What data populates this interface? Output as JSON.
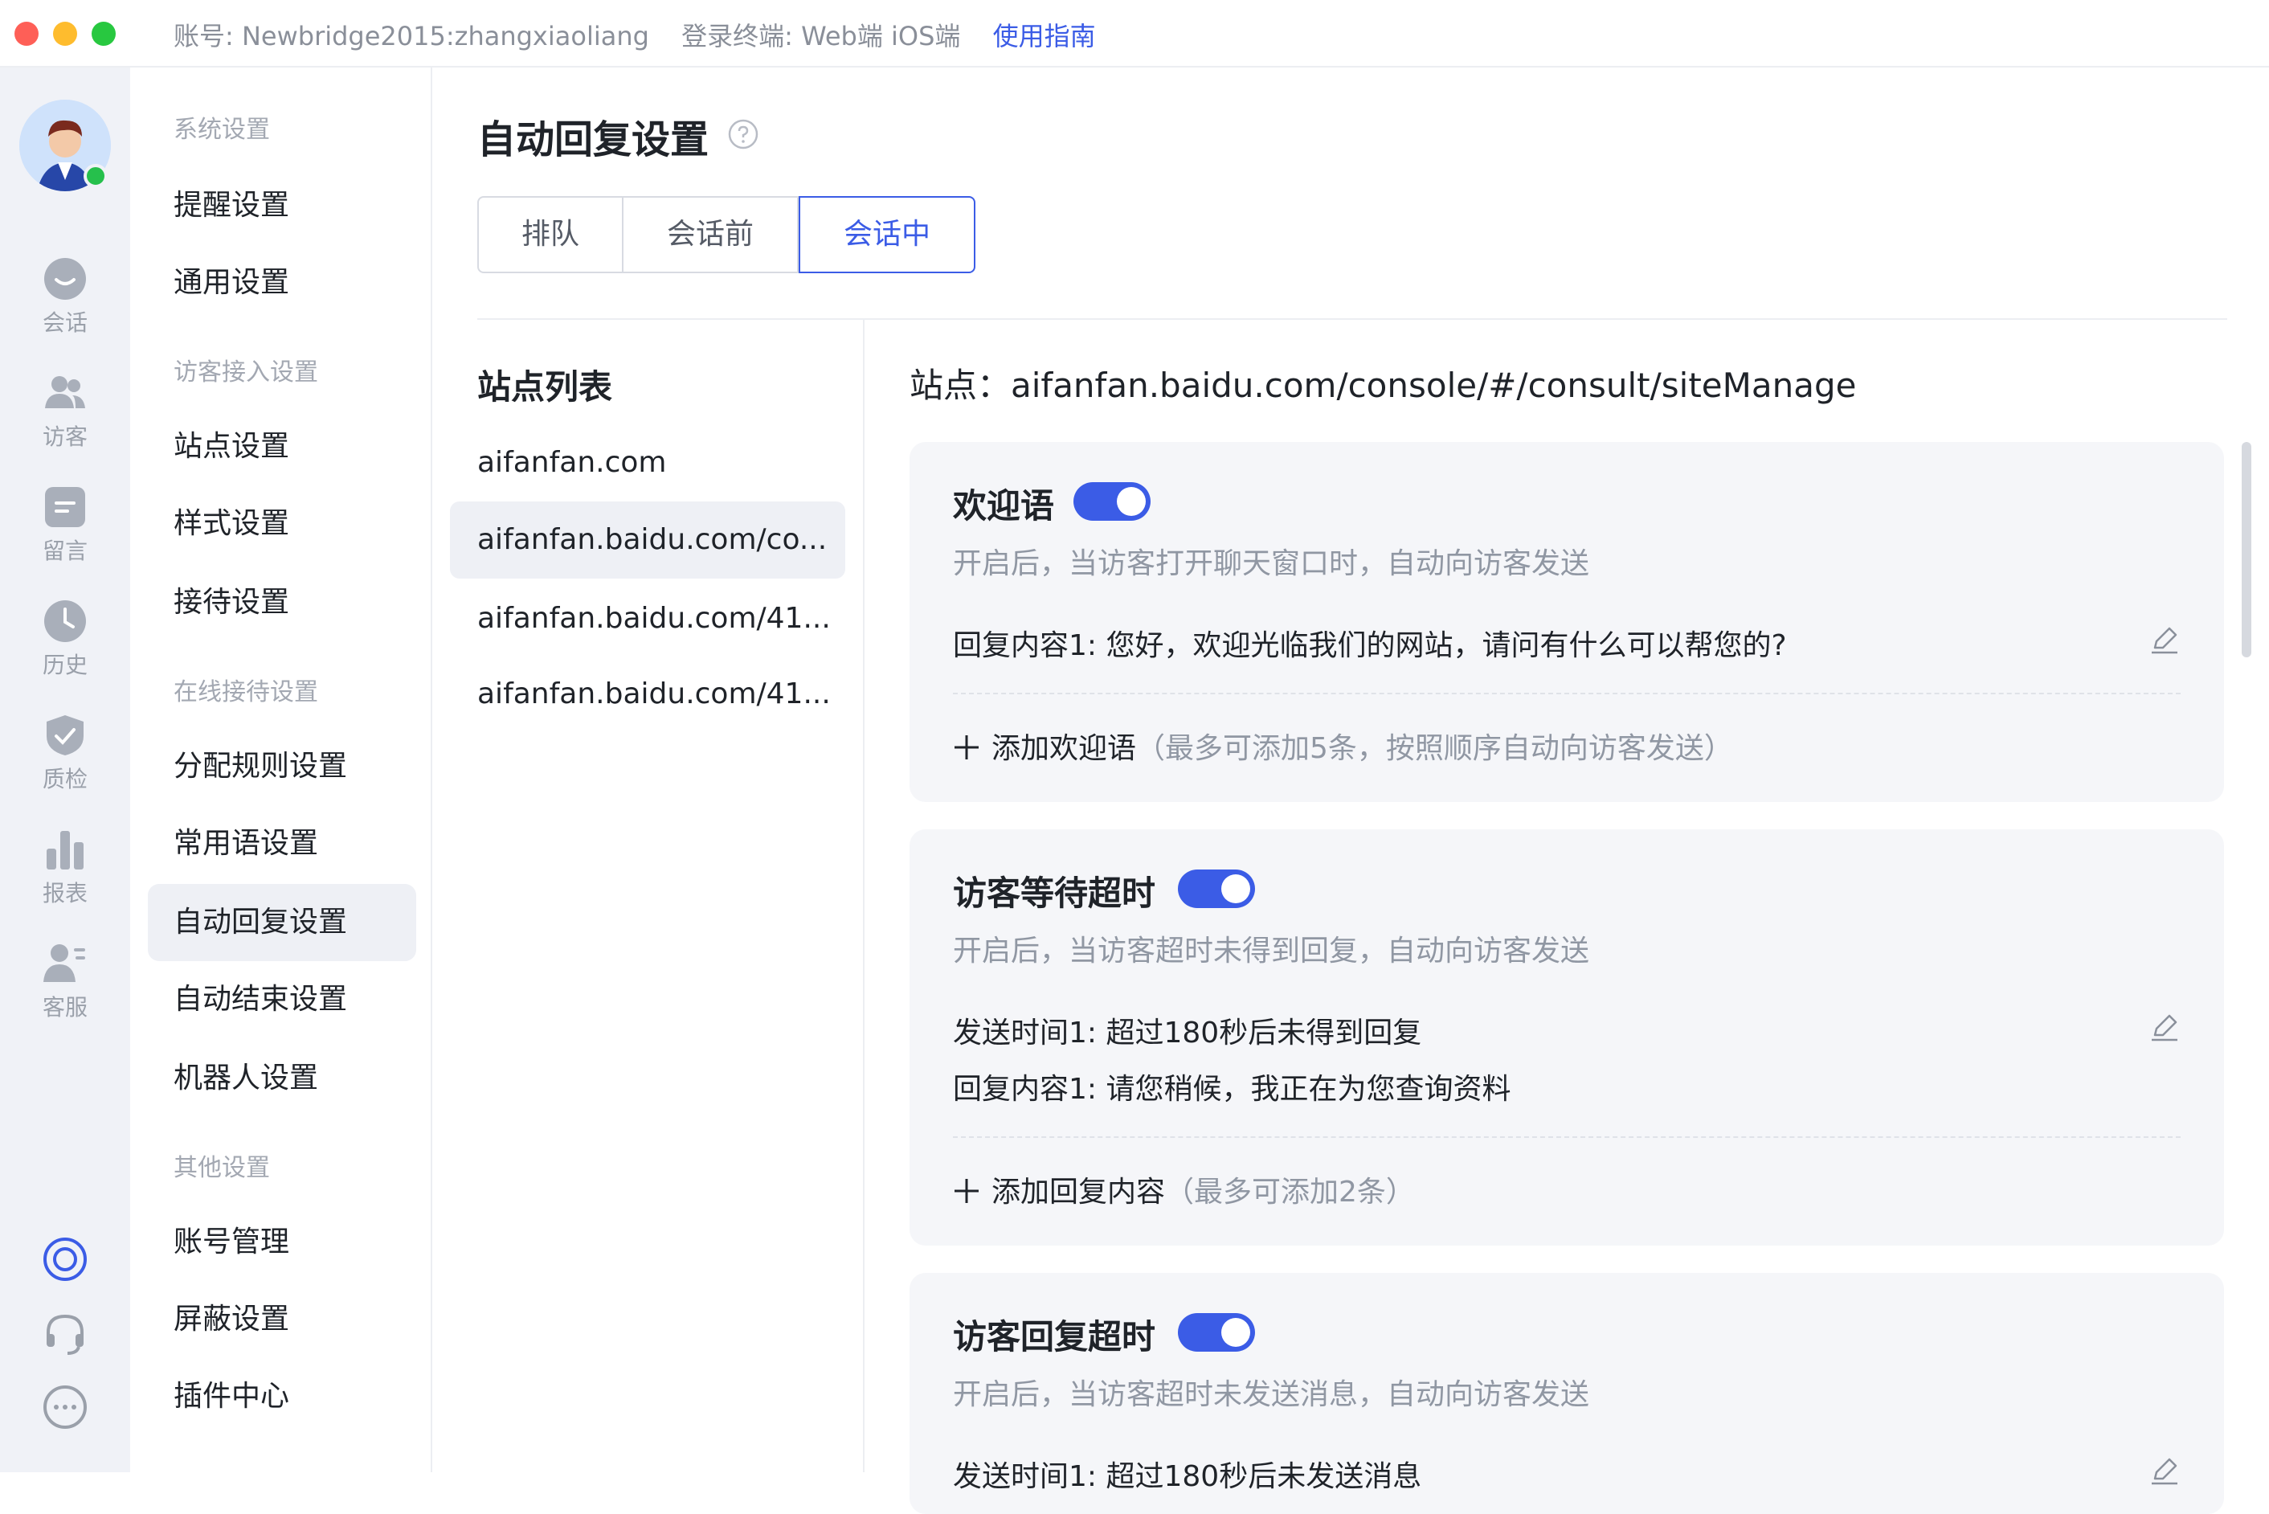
{
  "topbar": {
    "account": "账号: Newbridge2015:zhangxiaoliang",
    "terminal": "登录终端: Web端  iOS端",
    "guide": "使用指南"
  },
  "rail": {
    "items": [
      {
        "label": "会话",
        "icon": "chat-bubble-icon"
      },
      {
        "label": "访客",
        "icon": "visitors-icon"
      },
      {
        "label": "留言",
        "icon": "message-note-icon"
      },
      {
        "label": "历史",
        "icon": "clock-history-icon"
      },
      {
        "label": "质检",
        "icon": "quality-check-icon"
      },
      {
        "label": "报表",
        "icon": "bar-chart-icon"
      },
      {
        "label": "客服",
        "icon": "agent-icon"
      }
    ]
  },
  "menu": {
    "groups": [
      {
        "title": "系统设置",
        "items": [
          "提醒设置",
          "通用设置"
        ]
      },
      {
        "title": "访客接入设置",
        "items": [
          "站点设置",
          "样式设置",
          "接待设置"
        ]
      },
      {
        "title": "在线接待设置",
        "items": [
          "分配规则设置",
          "常用语设置",
          "自动回复设置",
          "自动结束设置",
          "机器人设置"
        ]
      },
      {
        "title": "其他设置",
        "items": [
          "账号管理",
          "屏蔽设置",
          "插件中心"
        ]
      }
    ],
    "active": "自动回复设置"
  },
  "page": {
    "title": "自动回复设置",
    "tabs": [
      "排队",
      "会话前",
      "会话中"
    ],
    "active_tab": "会话中"
  },
  "sites": {
    "title": "站点列表",
    "items": [
      "aifanfan.com",
      "aifanfan.baidu.com/co...",
      "aifanfan.baidu.com/41...",
      "aifanfan.baidu.com/41..."
    ],
    "active_index": 1
  },
  "site_header": "站点：aifanfan.baidu.com/console/#/consult/siteManage",
  "cards": {
    "welcome": {
      "title": "欢迎语",
      "enabled": true,
      "desc": "开启后，当访客打开聊天窗口时，自动向访客发送",
      "reply_label": "回复内容1:",
      "reply_value": "您好，欢迎光临我们的网站，请问有什么可以帮您的?",
      "add_label": "添加欢迎语",
      "add_hint": "（最多可添加5条，按照顺序自动向访客发送）"
    },
    "visitor_wait": {
      "title": "访客等待超时",
      "enabled": true,
      "desc": "开启后，当访客超时未得到回复，自动向访客发送",
      "time_label": "发送时间1:",
      "time_value": "超过180秒后未得到回复",
      "reply_label": "回复内容1:",
      "reply_value": "请您稍候，我正在为您查询资料",
      "add_label": "添加回复内容",
      "add_hint": "（最多可添加2条）"
    },
    "visitor_reply": {
      "title": "访客回复超时",
      "enabled": true,
      "desc": "开启后，当访客超时未发送消息，自动向访客发送",
      "time_label": "发送时间1:",
      "time_value": "超过180秒后未发送消息"
    }
  },
  "colors": {
    "accent": "#3b5ce6",
    "online": "#26c04c",
    "rail_bg": "#f0f2f7",
    "card_bg": "#f5f6f9"
  }
}
